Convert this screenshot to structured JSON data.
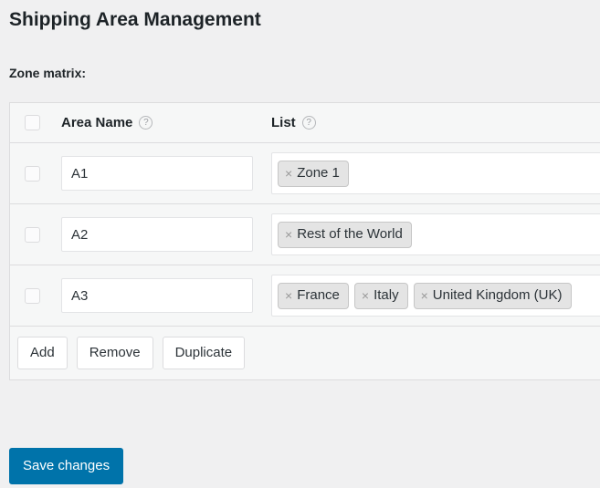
{
  "page": {
    "title": "Shipping Area Management",
    "field_label": "Zone matrix:"
  },
  "table": {
    "select_all_checkbox": "",
    "columns": [
      {
        "label": "Area Name",
        "help_icon": "?"
      },
      {
        "label": "List",
        "help_icon": "?"
      }
    ],
    "rows": [
      {
        "checked": false,
        "area_name": "A1",
        "area_name_placeholder": "",
        "tags": [
          {
            "remove": "×",
            "label": "Zone 1"
          }
        ]
      },
      {
        "checked": false,
        "area_name": "A2",
        "area_name_placeholder": "",
        "tags": [
          {
            "remove": "×",
            "label": "Rest of the World"
          }
        ]
      },
      {
        "checked": false,
        "area_name": "A3",
        "area_name_placeholder": "",
        "tags": [
          {
            "remove": "×",
            "label": "France"
          },
          {
            "remove": "×",
            "label": "Italy"
          },
          {
            "remove": "×",
            "label": "United Kingdom (UK)"
          }
        ]
      }
    ],
    "actions": {
      "add": "Add",
      "remove": "Remove",
      "duplicate": "Duplicate"
    }
  },
  "footer": {
    "save_label": "Save changes"
  },
  "colors": {
    "primary": "#0073aa",
    "page_background": "#f0f0f1",
    "table_background": "#f6f7f7",
    "border": "#dcdcde",
    "tag_background": "#e4e4e4",
    "text": "#1d2327"
  }
}
